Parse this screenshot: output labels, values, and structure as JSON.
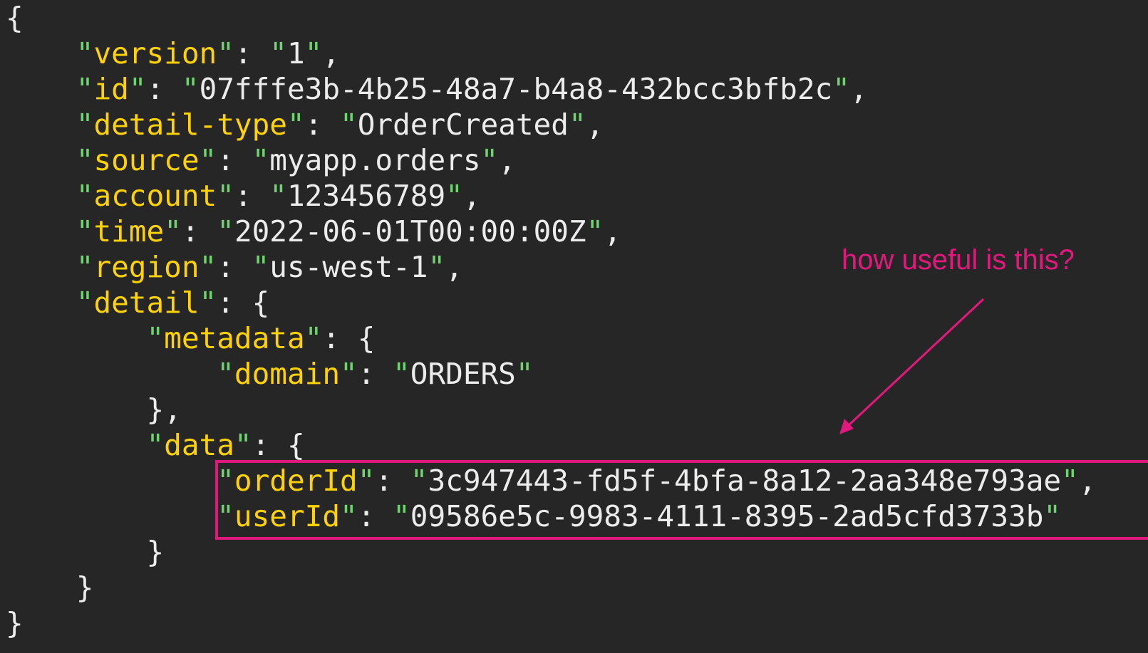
{
  "code_lines": [
    [
      {
        "t": "{",
        "c": "p"
      }
    ],
    [
      {
        "t": "    ",
        "c": "p"
      },
      {
        "t": "\"",
        "c": "q"
      },
      {
        "t": "version",
        "c": "k"
      },
      {
        "t": "\"",
        "c": "q"
      },
      {
        "t": ": ",
        "c": "p"
      },
      {
        "t": "\"",
        "c": "q"
      },
      {
        "t": "1",
        "c": "s"
      },
      {
        "t": "\"",
        "c": "q"
      },
      {
        "t": ",",
        "c": "p"
      }
    ],
    [
      {
        "t": "    ",
        "c": "p"
      },
      {
        "t": "\"",
        "c": "q"
      },
      {
        "t": "id",
        "c": "k"
      },
      {
        "t": "\"",
        "c": "q"
      },
      {
        "t": ": ",
        "c": "p"
      },
      {
        "t": "\"",
        "c": "q"
      },
      {
        "t": "07fffe3b-4b25-48a7-b4a8-432bcc3bfb2c",
        "c": "s"
      },
      {
        "t": "\"",
        "c": "q"
      },
      {
        "t": ",",
        "c": "p"
      }
    ],
    [
      {
        "t": "    ",
        "c": "p"
      },
      {
        "t": "\"",
        "c": "q"
      },
      {
        "t": "detail-type",
        "c": "k"
      },
      {
        "t": "\"",
        "c": "q"
      },
      {
        "t": ": ",
        "c": "p"
      },
      {
        "t": "\"",
        "c": "q"
      },
      {
        "t": "OrderCreated",
        "c": "s"
      },
      {
        "t": "\"",
        "c": "q"
      },
      {
        "t": ",",
        "c": "p"
      }
    ],
    [
      {
        "t": "    ",
        "c": "p"
      },
      {
        "t": "\"",
        "c": "q"
      },
      {
        "t": "source",
        "c": "k"
      },
      {
        "t": "\"",
        "c": "q"
      },
      {
        "t": ": ",
        "c": "p"
      },
      {
        "t": "\"",
        "c": "q"
      },
      {
        "t": "myapp.orders",
        "c": "s"
      },
      {
        "t": "\"",
        "c": "q"
      },
      {
        "t": ",",
        "c": "p"
      }
    ],
    [
      {
        "t": "    ",
        "c": "p"
      },
      {
        "t": "\"",
        "c": "q"
      },
      {
        "t": "account",
        "c": "k"
      },
      {
        "t": "\"",
        "c": "q"
      },
      {
        "t": ": ",
        "c": "p"
      },
      {
        "t": "\"",
        "c": "q"
      },
      {
        "t": "123456789",
        "c": "s"
      },
      {
        "t": "\"",
        "c": "q"
      },
      {
        "t": ",",
        "c": "p"
      }
    ],
    [
      {
        "t": "    ",
        "c": "p"
      },
      {
        "t": "\"",
        "c": "q"
      },
      {
        "t": "time",
        "c": "k"
      },
      {
        "t": "\"",
        "c": "q"
      },
      {
        "t": ": ",
        "c": "p"
      },
      {
        "t": "\"",
        "c": "q"
      },
      {
        "t": "2022-06-01T00:00:00Z",
        "c": "s"
      },
      {
        "t": "\"",
        "c": "q"
      },
      {
        "t": ",",
        "c": "p"
      }
    ],
    [
      {
        "t": "    ",
        "c": "p"
      },
      {
        "t": "\"",
        "c": "q"
      },
      {
        "t": "region",
        "c": "k"
      },
      {
        "t": "\"",
        "c": "q"
      },
      {
        "t": ": ",
        "c": "p"
      },
      {
        "t": "\"",
        "c": "q"
      },
      {
        "t": "us-west-1",
        "c": "s"
      },
      {
        "t": "\"",
        "c": "q"
      },
      {
        "t": ",",
        "c": "p"
      }
    ],
    [
      {
        "t": "    ",
        "c": "p"
      },
      {
        "t": "\"",
        "c": "q"
      },
      {
        "t": "detail",
        "c": "k"
      },
      {
        "t": "\"",
        "c": "q"
      },
      {
        "t": ": {",
        "c": "p"
      }
    ],
    [
      {
        "t": "        ",
        "c": "p"
      },
      {
        "t": "\"",
        "c": "q"
      },
      {
        "t": "metadata",
        "c": "k"
      },
      {
        "t": "\"",
        "c": "q"
      },
      {
        "t": ": {",
        "c": "p"
      }
    ],
    [
      {
        "t": "            ",
        "c": "p"
      },
      {
        "t": "\"",
        "c": "q"
      },
      {
        "t": "domain",
        "c": "k"
      },
      {
        "t": "\"",
        "c": "q"
      },
      {
        "t": ": ",
        "c": "p"
      },
      {
        "t": "\"",
        "c": "q"
      },
      {
        "t": "ORDERS",
        "c": "s"
      },
      {
        "t": "\"",
        "c": "q"
      }
    ],
    [
      {
        "t": "        },",
        "c": "p"
      }
    ],
    [
      {
        "t": "        ",
        "c": "p"
      },
      {
        "t": "\"",
        "c": "q"
      },
      {
        "t": "data",
        "c": "k"
      },
      {
        "t": "\"",
        "c": "q"
      },
      {
        "t": ": {",
        "c": "p"
      }
    ],
    [
      {
        "t": "            ",
        "c": "p"
      },
      {
        "t": "\"",
        "c": "q"
      },
      {
        "t": "orderId",
        "c": "k"
      },
      {
        "t": "\"",
        "c": "q"
      },
      {
        "t": ": ",
        "c": "p"
      },
      {
        "t": "\"",
        "c": "q"
      },
      {
        "t": "3c947443-fd5f-4bfa-8a12-2aa348e793ae",
        "c": "s"
      },
      {
        "t": "\"",
        "c": "q"
      },
      {
        "t": ",",
        "c": "p"
      }
    ],
    [
      {
        "t": "            ",
        "c": "p"
      },
      {
        "t": "\"",
        "c": "q"
      },
      {
        "t": "userId",
        "c": "k"
      },
      {
        "t": "\"",
        "c": "q"
      },
      {
        "t": ": ",
        "c": "p"
      },
      {
        "t": "\"",
        "c": "q"
      },
      {
        "t": "09586e5c-9983-4111-8395-2ad5cfd3733b",
        "c": "s"
      },
      {
        "t": "\"",
        "c": "q"
      }
    ],
    [
      {
        "t": "        }",
        "c": "p"
      }
    ],
    [
      {
        "t": "    }",
        "c": "p"
      }
    ],
    [
      {
        "t": "}",
        "c": "p"
      }
    ]
  ],
  "annotation": {
    "text": "how useful is this?",
    "color": "#e3187e"
  },
  "colors": {
    "background": "#262626",
    "key": "#ffd200",
    "quote": "#6ed46e",
    "text": "#ececec",
    "highlight": "#e3187e"
  }
}
